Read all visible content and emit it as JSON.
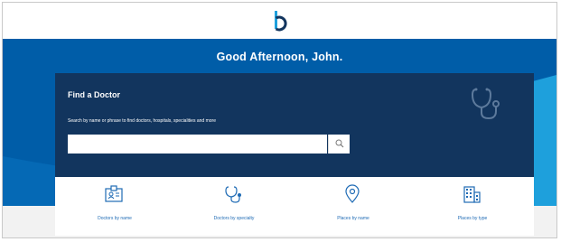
{
  "header": {
    "logo_icon": "b-logo-icon"
  },
  "hero": {
    "greeting": "Good Afternoon, John."
  },
  "find_doctor": {
    "title": "Find a Doctor",
    "description": "Search by name or phrase to find doctors, hospitals, specialities and more",
    "search_value": "",
    "search_icon": "search-icon",
    "decor_icon": "stethoscope-icon"
  },
  "quick_links": [
    {
      "label": "Doctors by name",
      "icon": "id-card-icon"
    },
    {
      "label": "Doctors by specialty",
      "icon": "stethoscope-icon"
    },
    {
      "label": "Places by name",
      "icon": "location-pin-icon"
    },
    {
      "label": "Places by type",
      "icon": "building-icon"
    }
  ],
  "colors": {
    "hero_blue": "#005da8",
    "card_navy": "#12355e",
    "accent_light_blue": "#1ea0dc",
    "link_blue": "#1f6bb5"
  }
}
